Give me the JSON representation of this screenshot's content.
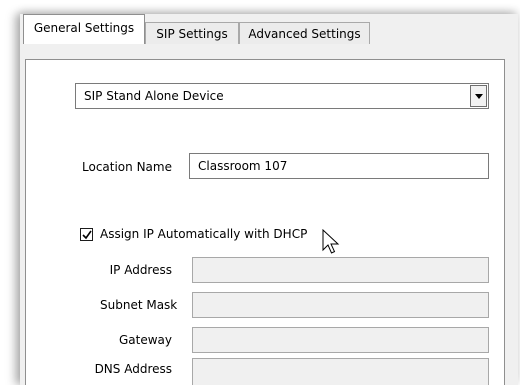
{
  "tabs": [
    {
      "label": "General Settings",
      "active": true
    },
    {
      "label": "SIP Settings",
      "active": false
    },
    {
      "label": "Advanced Settings",
      "active": false
    }
  ],
  "device_type": {
    "selected": "SIP Stand Alone Device"
  },
  "location": {
    "label": "Location Name",
    "value": "Classroom 107"
  },
  "dhcp": {
    "label": "Assign IP Automatically with DHCP",
    "checked": true
  },
  "network": {
    "ip_address": {
      "label": "IP Address",
      "value": ""
    },
    "subnet_mask": {
      "label": "Subnet Mask",
      "value": ""
    },
    "gateway": {
      "label": "Gateway",
      "value": ""
    },
    "dns_address": {
      "label": "DNS Address",
      "value": ""
    }
  },
  "icons": {
    "dropdown_arrow": "chevron-down-icon",
    "checkmark": "checkmark-icon",
    "cursor": "mouse-pointer-icon"
  },
  "colors": {
    "panel_background": "#f0f0f0",
    "content_background": "#ffffff",
    "disabled_field": "#f0f0f0",
    "border": "#7a7a7a"
  }
}
